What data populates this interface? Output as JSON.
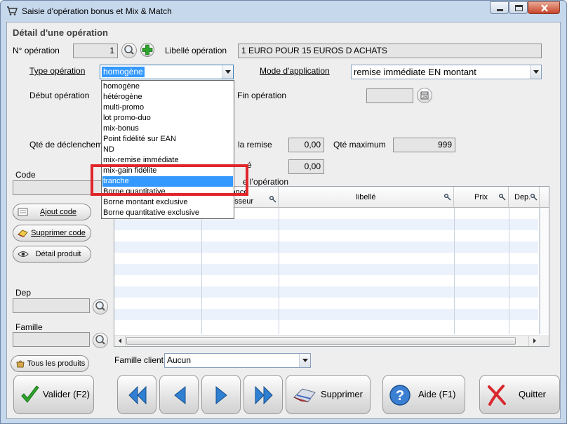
{
  "window": {
    "title": "Saisie d'opération bonus et Mix & Match",
    "controls": [
      "minimize",
      "maximize",
      "close"
    ]
  },
  "section_title": "Détail d'une opération",
  "fields": {
    "num_label": "N° opération",
    "num_value": "1",
    "libelle_label": "Libellé opération",
    "libelle_value": "1 EURO POUR 15 EUROS D ACHATS",
    "type_label": "Type opération",
    "type_value": "homogène",
    "mode_label": "Mode d'application",
    "mode_value": "remise immédiate EN montant",
    "debut_label": "Début opération",
    "fin_label": "Fin opération",
    "qte_decl_label": "Qté de déclenchement",
    "remise_label": "la remise",
    "remise_value": "0,00",
    "qte_max_label": "Qté maximum",
    "qte_max_value": "999",
    "partial_label_2": "é",
    "second_value": "0,00",
    "operation_label": "e l'opération",
    "code_label": "Code",
    "dep_label": "Dep",
    "famille_label": "Famille",
    "famille_client_label": "Famille client",
    "famille_client_value": "Aucun"
  },
  "dropdown": {
    "options": [
      "homogène",
      "hétérogène",
      "multi-promo",
      "lot promo-duo",
      "mix-bonus",
      "Point fidélité sur EAN",
      "ND",
      "mix-remise immédiate",
      "mix-gain fidélite",
      "tranche",
      "Borne quantitative",
      "Borne montant exclusive",
      "Borne quantitative exclusive"
    ],
    "selected": "tranche"
  },
  "side_buttons": {
    "ajout": "Ajout code",
    "supprimer": "Supprimer code",
    "detail": "Détail produit",
    "tous": "Tous les produits"
  },
  "grid": {
    "columns": [
      "",
      "rnisseur",
      "libellé",
      "Prix",
      "Dep."
    ],
    "header_fragment": "ance"
  },
  "bottom_buttons": {
    "valider": "Valider (F2)",
    "supprimer": "Supprimer",
    "aide": "Aide (F1)",
    "quitter": "Quitter"
  },
  "colors": {
    "selection": "#3399ff",
    "highlight_box": "#e0262b",
    "valider_check": "#2aa52a",
    "nav_arrow": "#2f7fd2",
    "quitter_x": "#d9272e"
  }
}
